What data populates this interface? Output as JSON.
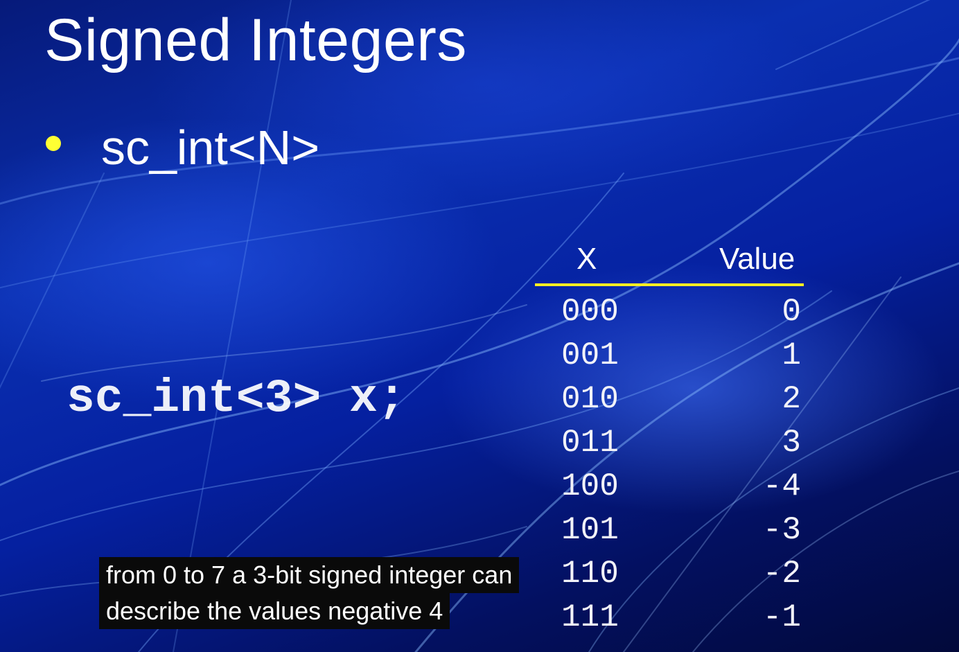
{
  "slide": {
    "title": "Signed Integers",
    "bullet": "sc_int<N>",
    "code": "sc_int<3> x;",
    "colors": {
      "bullet": "#ffff33",
      "rule": "#ffee22",
      "text": "#ffffff"
    }
  },
  "table": {
    "headers": {
      "x": "X",
      "value": "Value"
    },
    "rows": [
      {
        "x": "000",
        "value": "0"
      },
      {
        "x": "001",
        "value": "1"
      },
      {
        "x": "010",
        "value": "2"
      },
      {
        "x": "011",
        "value": "3"
      },
      {
        "x": "100",
        "value": "-4"
      },
      {
        "x": "101",
        "value": "-3"
      },
      {
        "x": "110",
        "value": "-2"
      },
      {
        "x": "111",
        "value": "-1"
      }
    ]
  },
  "captions": [
    "from 0 to 7 a 3-bit signed integer can",
    "describe the values negative 4"
  ]
}
